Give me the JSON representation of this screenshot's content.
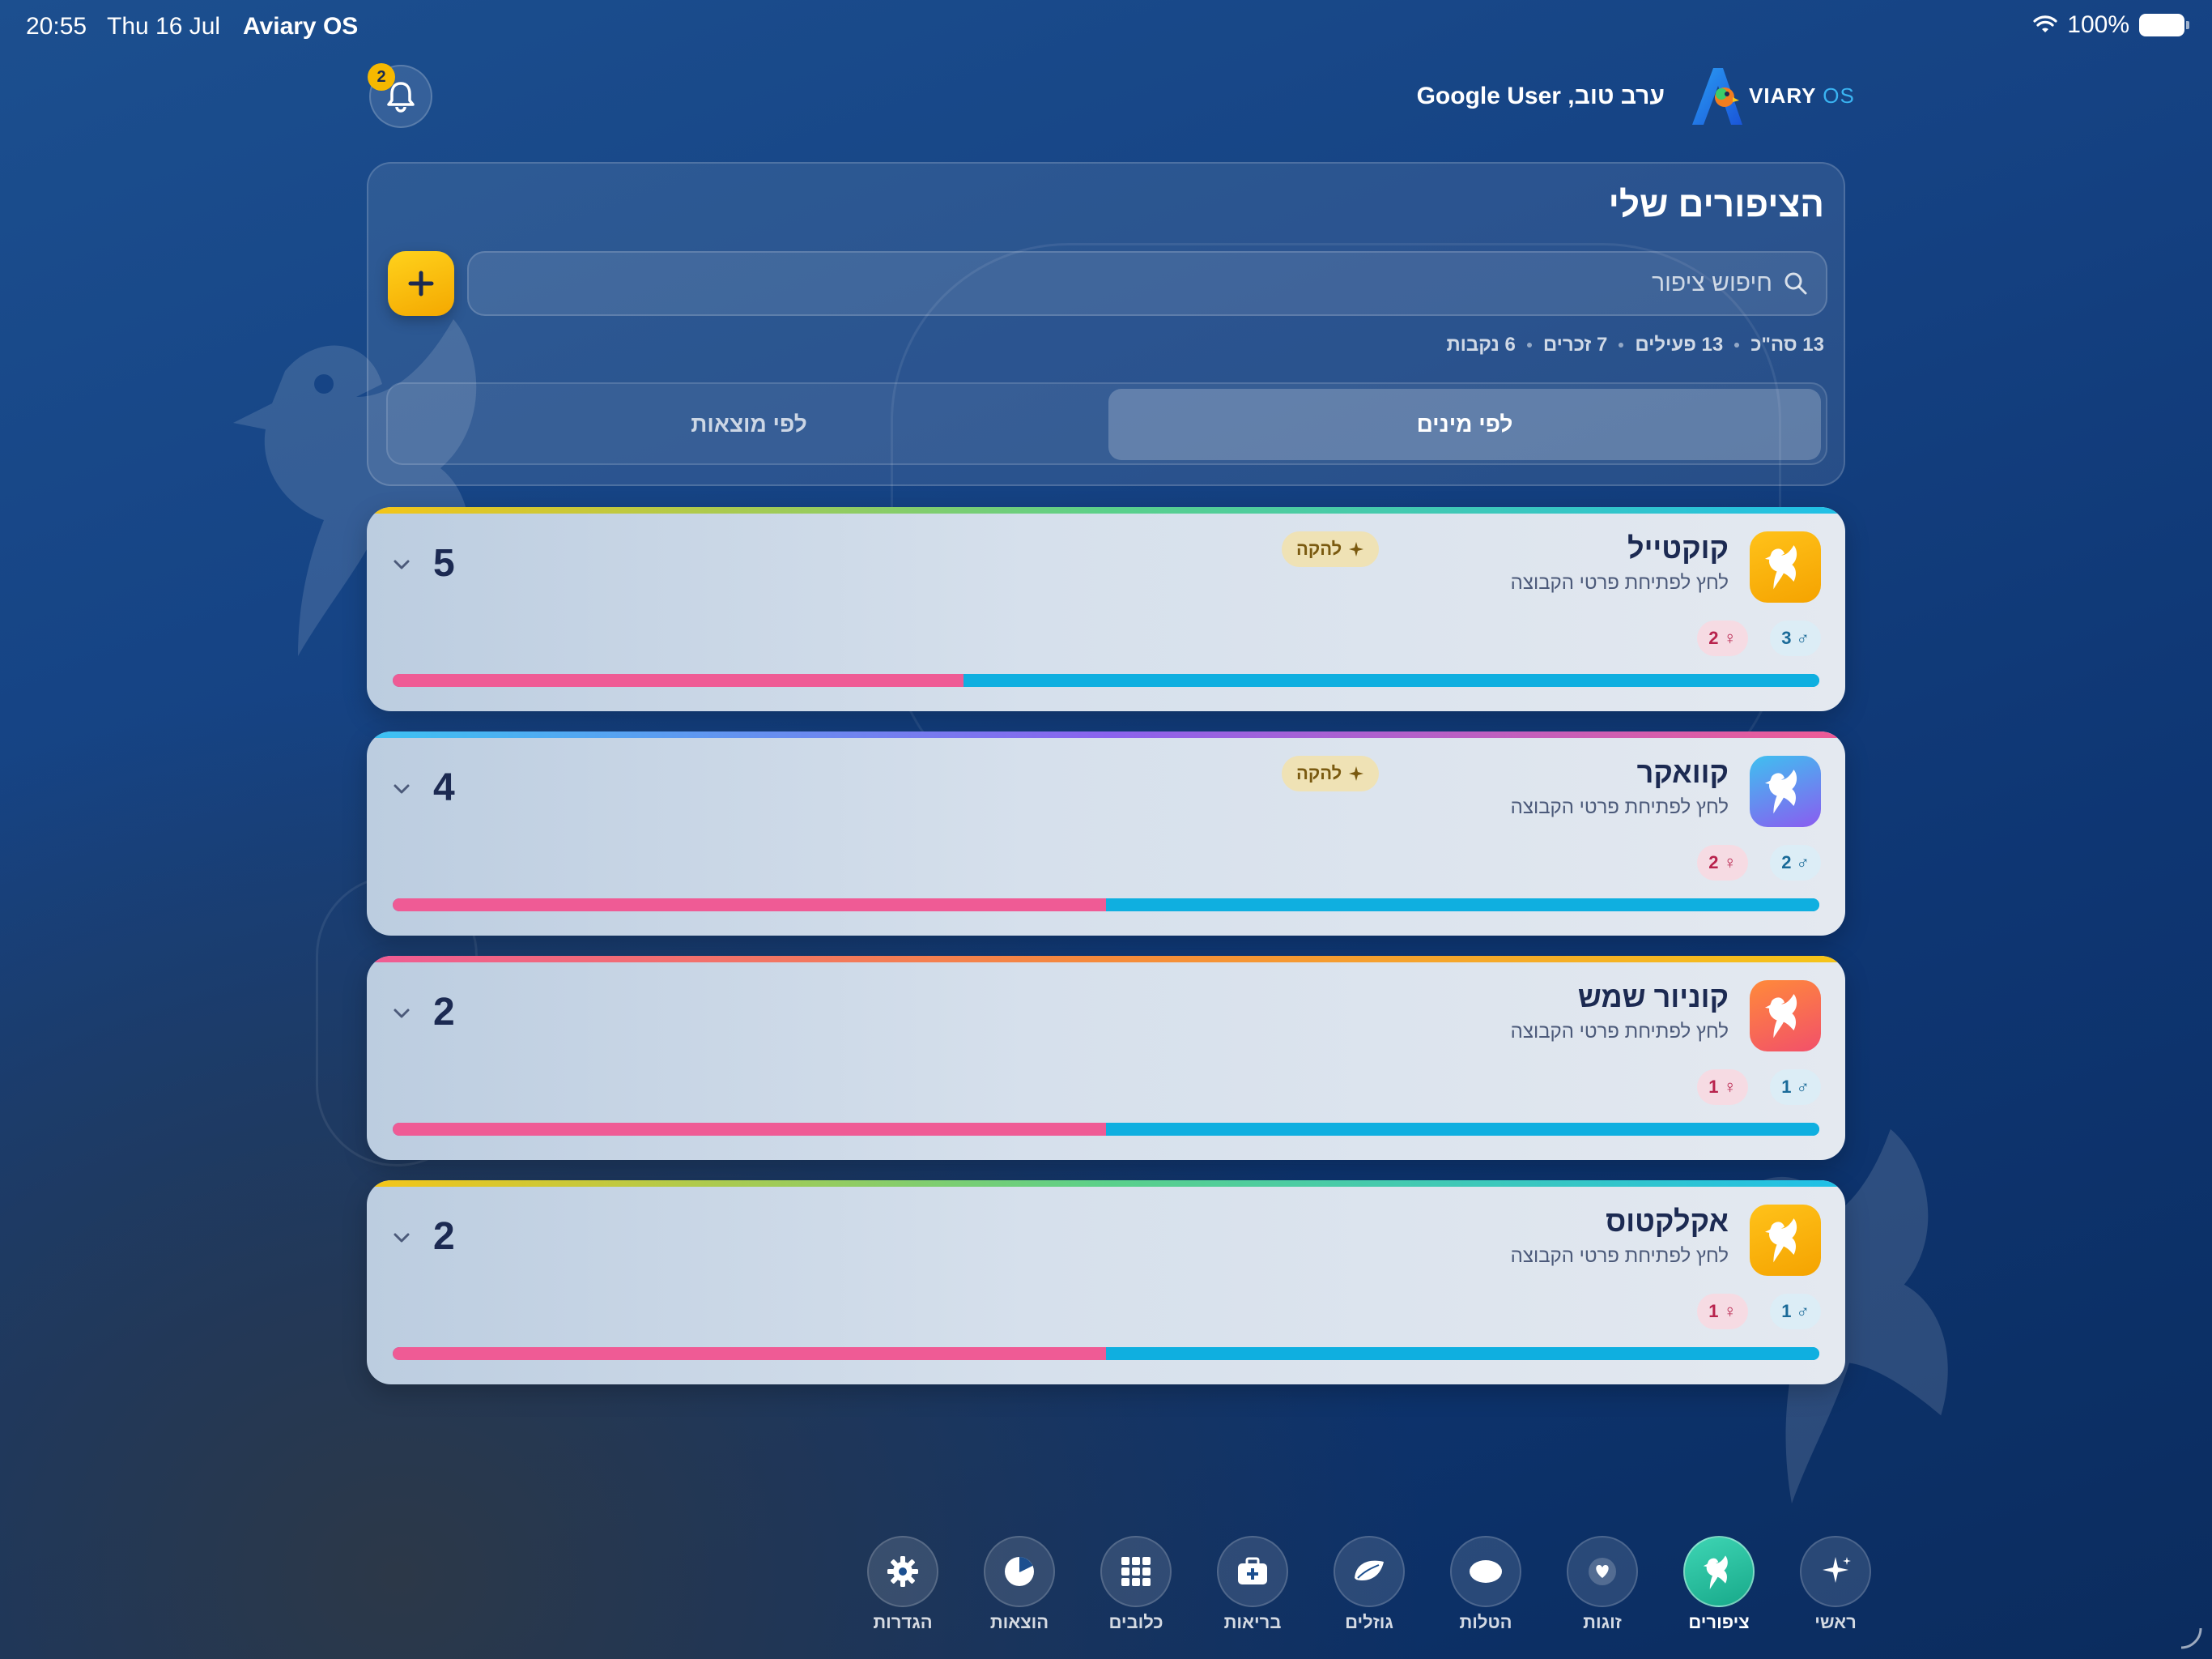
{
  "status_bar": {
    "time": "20:55",
    "date": "Thu 16 Jul",
    "app_name": "Aviary OS",
    "battery": "100%"
  },
  "header": {
    "notification_count": "2",
    "greeting": "ערב טוב, Google User",
    "logo_name": "VIARY",
    "logo_os": "OS"
  },
  "panel": {
    "title": "הציפורים שלי",
    "search_placeholder": "חיפוש ציפור",
    "stats": [
      "13 סה\"כ",
      "13 פעילים",
      "7 זכרים",
      "6 נקבות"
    ],
    "tabs": [
      {
        "label": "לפי מינים",
        "active": true
      },
      {
        "label": "לפי מוצאות",
        "active": false
      }
    ]
  },
  "card_subtitle": "לחץ לפתיחת פרטי הקבוצה",
  "flock_label": "להקה",
  "species": [
    {
      "name": "קוקטייל",
      "count": "5",
      "males": "3",
      "females": "2",
      "female_fraction": 0.4,
      "flock": true,
      "icon_colors": [
        "#ffc21a",
        "#f5a300"
      ],
      "top_gradient": "linear-gradient(90deg,#f5c518,#5bd08a,#20c0e8)"
    },
    {
      "name": "קוואקר",
      "count": "4",
      "males": "2",
      "females": "2",
      "female_fraction": 0.5,
      "flock": true,
      "icon_colors": [
        "#3fc0f0",
        "#8a5cf0"
      ],
      "top_gradient": "linear-gradient(90deg,#3cc3f3,#8a63ee,#ef5b95)"
    },
    {
      "name": "קוניור שמש",
      "count": "2",
      "males": "1",
      "females": "1",
      "female_fraction": 0.5,
      "flock": false,
      "icon_colors": [
        "#ff8a3a",
        "#f2506a"
      ],
      "top_gradient": "linear-gradient(90deg,#ef5b95,#f58a3a,#f5c518)"
    },
    {
      "name": "אקלקטוס",
      "count": "2",
      "males": "1",
      "females": "1",
      "female_fraction": 0.5,
      "flock": false,
      "icon_colors": [
        "#ffc21a",
        "#f5a300"
      ],
      "top_gradient": "linear-gradient(90deg,#f5c518,#5bd08a,#20c0e8)"
    }
  ],
  "nav": [
    {
      "label": "ראשי",
      "icon": "sparkle-icon"
    },
    {
      "label": "ציפורים",
      "icon": "bird-icon",
      "active": true
    },
    {
      "label": "זוגות",
      "icon": "heart-icon"
    },
    {
      "label": "הטלות",
      "icon": "egg-icon"
    },
    {
      "label": "גוזלים",
      "icon": "leaf-icon"
    },
    {
      "label": "בריאות",
      "icon": "medical-kit-icon"
    },
    {
      "label": "כלובים",
      "icon": "grid-icon"
    },
    {
      "label": "הוצאות",
      "icon": "pie-chart-icon"
    },
    {
      "label": "הגדרות",
      "icon": "gear-icon"
    }
  ]
}
